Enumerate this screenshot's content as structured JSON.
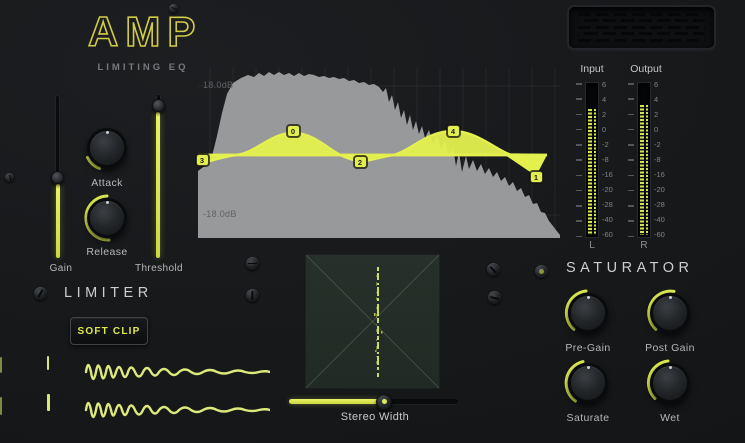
{
  "header": {
    "logo": "AMP",
    "subtitle": "LIMITING EQ"
  },
  "colors": {
    "accent": "#dcea4d",
    "logo": "#d2cb45",
    "panel": "#17191c",
    "spectrum": "#9d9ea0"
  },
  "left_panel": {
    "gain_label": "Gain",
    "attack_label": "Attack",
    "release_label": "Release",
    "threshold_label": "Threshold"
  },
  "eq": {
    "db_top": "18.0dB",
    "db_bottom": "-18.0dB",
    "handles": [
      {
        "label": "3"
      },
      {
        "label": "0"
      },
      {
        "label": "2"
      },
      {
        "label": "4"
      },
      {
        "label": "1"
      }
    ]
  },
  "meters": {
    "input_label": "Input",
    "output_label": "Output",
    "left_label": "L",
    "right_label": "R",
    "scale": [
      "6",
      "4",
      "2",
      "0",
      "-2",
      "-8",
      "-16",
      "-20",
      "-28",
      "-40",
      "-60"
    ]
  },
  "limiter": {
    "title": "LIMITER",
    "soft_clip_label": "SOFT CLIP"
  },
  "stereo": {
    "width_label": "Stereo Width"
  },
  "saturator": {
    "title": "SATURATOR",
    "pre_gain_label": "Pre-Gain",
    "post_gain_label": "Post Gain",
    "saturate_label": "Saturate",
    "wet_label": "Wet"
  }
}
